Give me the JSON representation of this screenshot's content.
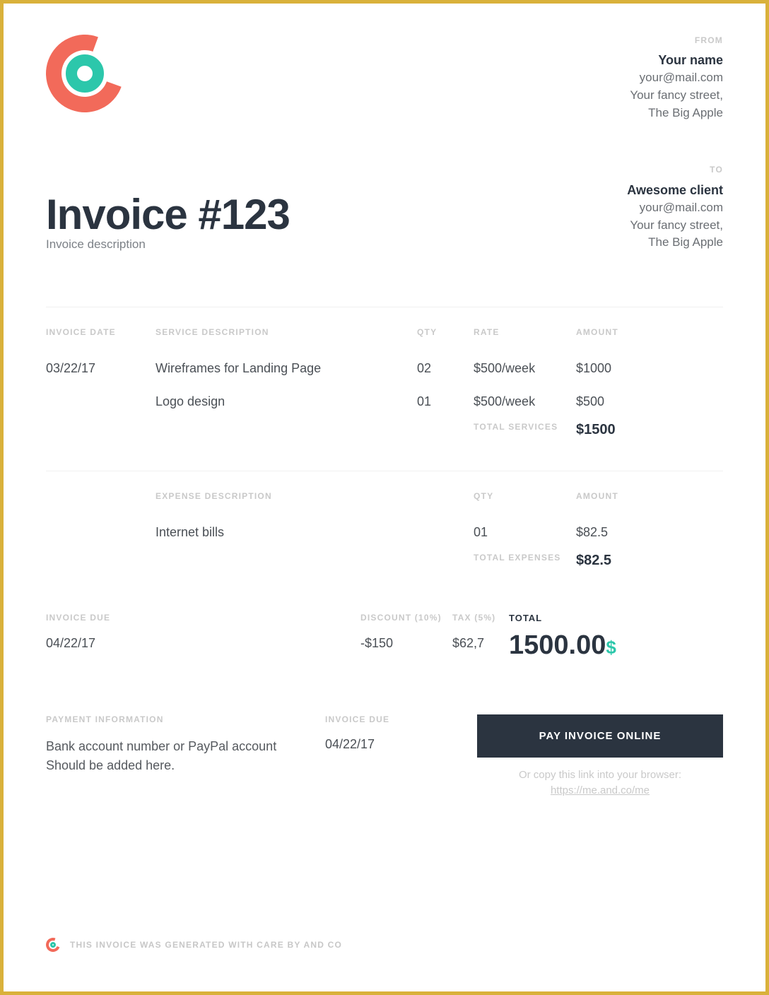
{
  "from": {
    "label": "FROM",
    "name": "Your name",
    "email": "your@mail.com",
    "street": "Your fancy street,",
    "city": "The Big Apple"
  },
  "to": {
    "label": "TO",
    "name": "Awesome client",
    "email": "your@mail.com",
    "street": "Your fancy street,",
    "city": "The Big Apple"
  },
  "invoice": {
    "title": "Invoice #123",
    "subtitle": "Invoice description",
    "date_label": "INVOICE DATE",
    "date": "03/22/17",
    "due_label": "INVOICE DUE",
    "due": "04/22/17"
  },
  "services": {
    "hdr_desc": "SERVICE DESCRIPTION",
    "hdr_qty": "QTY",
    "hdr_rate": "RATE",
    "hdr_amt": "AMOUNT",
    "items": [
      {
        "desc": "Wireframes for Landing Page",
        "qty": "02",
        "rate": "$500/week",
        "amount": "$1000"
      },
      {
        "desc": "Logo design",
        "qty": "01",
        "rate": "$500/week",
        "amount": "$500"
      }
    ],
    "subtotal_label": "TOTAL SERVICES",
    "subtotal": "$1500"
  },
  "expenses": {
    "hdr_desc": "EXPENSE DESCRIPTION",
    "hdr_qty": "QTY",
    "hdr_amt": "AMOUNT",
    "items": [
      {
        "desc": "Internet bills",
        "qty": "01",
        "amount": "$82.5"
      }
    ],
    "subtotal_label": "TOTAL EXPENSES",
    "subtotal": "$82.5"
  },
  "summary": {
    "discount_label": "DISCOUNT (10%)",
    "discount": "-$150",
    "tax_label": "TAX (5%)",
    "tax": "$62,7",
    "total_label": "TOTAL",
    "total": "1500.00",
    "currency": "$"
  },
  "payment": {
    "info_label": "PAYMENT INFORMATION",
    "info_text1": "Bank account number or PayPal account",
    "info_text2": "Should be added here.",
    "due_label": "INVOICE DUE",
    "due": "04/22/17",
    "button": "PAY INVOICE ONLINE",
    "copy_prefix": "Or copy this link into your browser: ",
    "copy_link": "https://me.and.co/me"
  },
  "footer": "THIS INVOICE WAS GENERATED WITH CARE BY AND CO"
}
